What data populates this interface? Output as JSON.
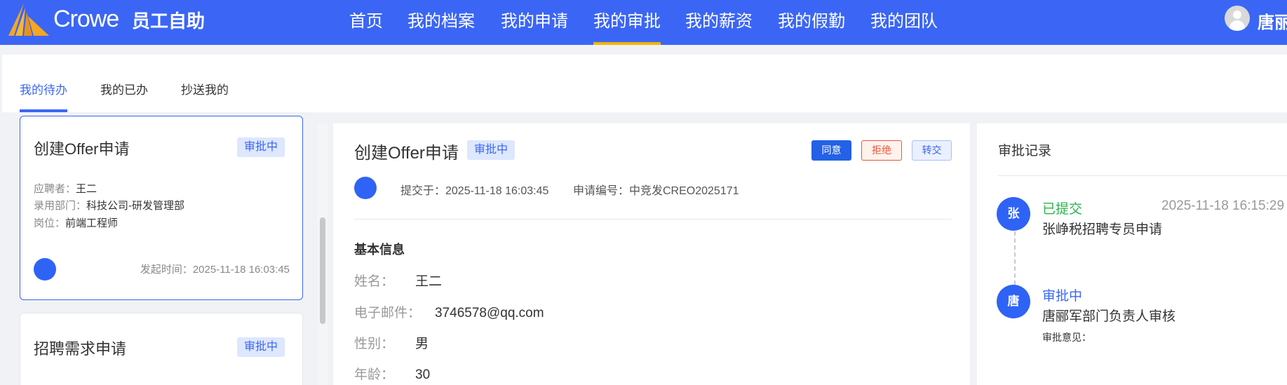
{
  "header": {
    "brand": "Crowe",
    "app_title": "员工自助",
    "nav": [
      "首页",
      "我的档案",
      "我的申请",
      "我的审批",
      "我的薪资",
      "我的假勤",
      "我的团队"
    ],
    "active_nav": "我的审批",
    "username": "唐丽"
  },
  "tabs": {
    "items": [
      "我的待办",
      "我的已办",
      "抄送我的"
    ],
    "active": "我的待办"
  },
  "list": [
    {
      "title": "创建Offer申请",
      "status": "审批中",
      "applicant_label": "应聘者：",
      "applicant": "王二",
      "dept_label": "录用部门：",
      "dept": "科技公司-研发管理部",
      "position_label": "岗位：",
      "position": "前端工程师",
      "created_label": "发起时间：",
      "created": "2025-11-18 16:03:45"
    },
    {
      "title": "招聘需求申请",
      "status": "审批中"
    }
  ],
  "detail": {
    "title": "创建Offer申请",
    "status": "审批中",
    "actions": {
      "agree": "同意",
      "reject": "拒绝",
      "transfer": "转交"
    },
    "submitted": "提交于：2025-11-18 16:03:45",
    "code": "申请编号：中竞发CREO2025171",
    "section": "基本信息",
    "fields": [
      {
        "label": "姓名：",
        "value": "王二"
      },
      {
        "label": "电子邮件：",
        "value": "3746578@qq.com"
      },
      {
        "label": "性别：",
        "value": "男"
      },
      {
        "label": "年龄：",
        "value": "30"
      }
    ]
  },
  "records": {
    "title": "审批记录",
    "items": [
      {
        "avatar": "张",
        "status": "已提交",
        "status_color": "#2bb24c",
        "time": "2025-11-18 16:15:29",
        "desc": "张峥税招聘专员申请"
      },
      {
        "avatar": "唐",
        "status": "审批中",
        "status_color": "#3b66f5",
        "desc": "唐郦军部门负责人审核",
        "opinion": "审批意见："
      }
    ]
  },
  "colors": {
    "primary": "#3b66f5",
    "nav_active_underline": "#f5b400",
    "reject": "#e8563a"
  }
}
